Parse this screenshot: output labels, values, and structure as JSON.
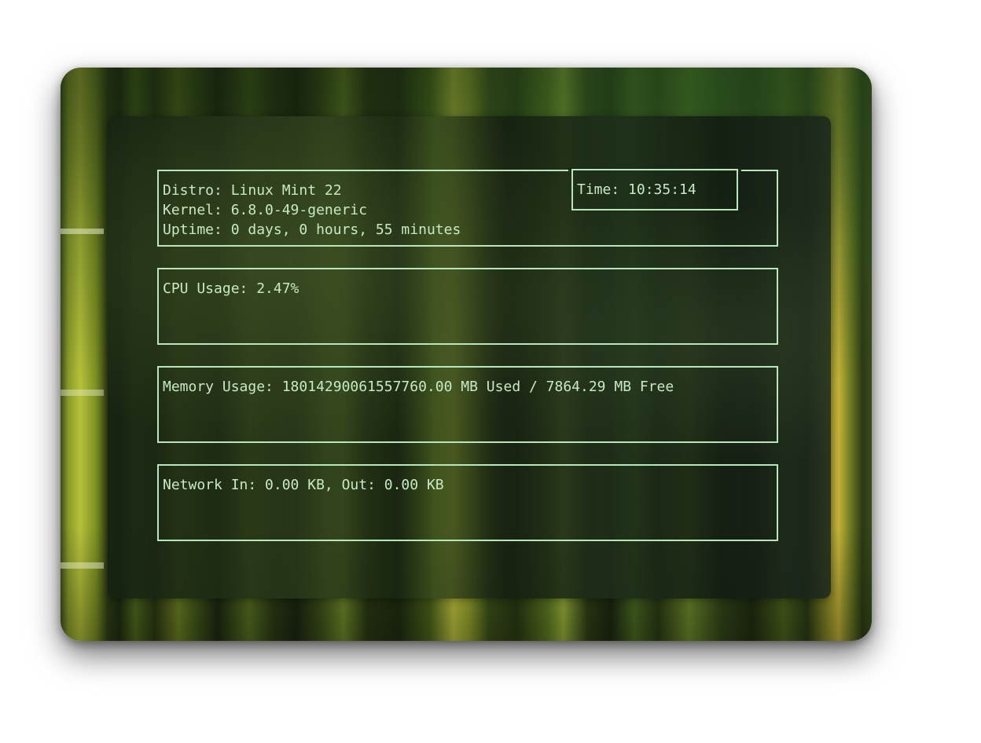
{
  "system": {
    "distro": "Distro: Linux Mint 22",
    "kernel": "Kernel: 6.8.0-49-generic",
    "uptime": "Uptime: 0 days, 0 hours, 55 minutes"
  },
  "time": {
    "label": "Time: 10:35:14"
  },
  "cpu": {
    "label": "CPU Usage: 2.47%"
  },
  "memory": {
    "label": "Memory Usage: 18014290061557760.00 MB Used / 7864.29 MB Free"
  },
  "network": {
    "label": "Network In: 0.00 KB, Out: 0.00 KB"
  },
  "colors": {
    "accent": "#b9e7bd",
    "text": "#c8e9c5"
  }
}
